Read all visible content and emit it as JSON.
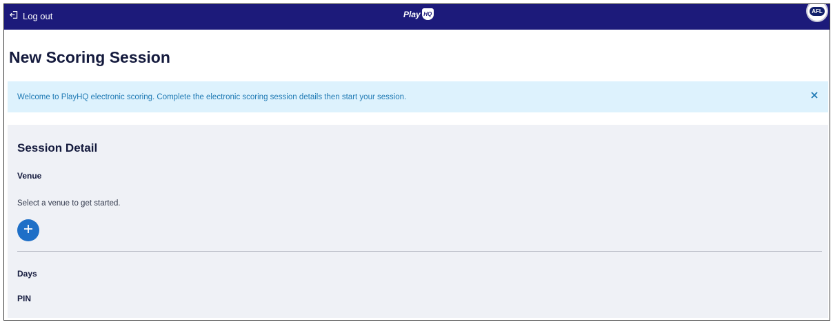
{
  "topbar": {
    "logout_label": "Log out",
    "logout_icon": "logout-icon",
    "brand_text": "Play",
    "brand_mark": "HQ",
    "org_logo_text": "AFL",
    "background_color": "#1c1a7a"
  },
  "page": {
    "title": "New Scoring Session"
  },
  "alert": {
    "message": "Welcome to PlayHQ electronic scoring. Complete the electronic scoring session details then start your session.",
    "close_icon": "close-icon",
    "background_color": "#ddf2fd",
    "text_color": "#1f7ab4"
  },
  "session_detail": {
    "title": "Session Detail",
    "venue_label": "Venue",
    "venue_hint": "Select a venue to get started.",
    "add_venue_icon": "plus-icon",
    "days_label": "Days",
    "pin_label": "PIN",
    "accent_color": "#1e6fc7"
  }
}
